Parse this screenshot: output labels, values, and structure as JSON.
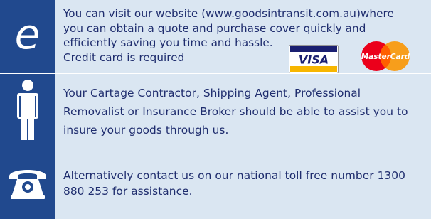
{
  "panels": [
    {
      "icon": "e-letter-icon",
      "icon_text": "e",
      "lines": [
        "You can visit our website (www.goodsintransit.com.au)where",
        "you can obtain a quote and purchase cover quickly and",
        "efficiently saving you time and hassle.",
        "Credit card is required"
      ]
    },
    {
      "icon": "person-icon",
      "lines": [
        "Your Cartage Contractor, Shipping Agent, Professional",
        "Removalist or Insurance Broker should be able to assist you to",
        "insure your goods through us."
      ]
    },
    {
      "icon": "telephone-icon",
      "lines": [
        "Alternatively contact us on our  national toll free number 1300",
        "880 253 for assistance."
      ]
    }
  ],
  "card_logos": {
    "visa": "VISA",
    "mastercard": "MasterCard"
  },
  "colors": {
    "panel_bg": "#dae6f2",
    "icon_bg": "#21498e",
    "text": "#1f2d6e"
  }
}
